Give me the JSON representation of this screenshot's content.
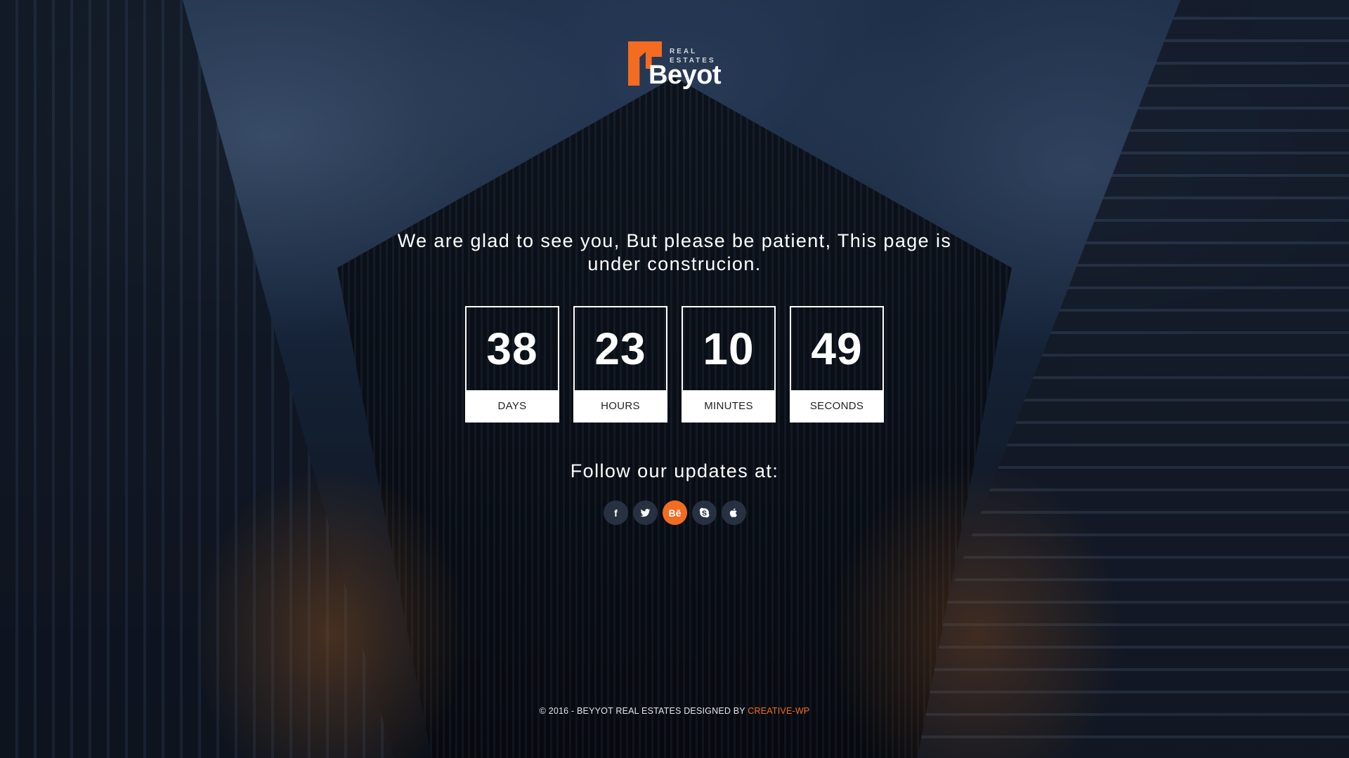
{
  "brand": {
    "subtitle_line1": "REAL",
    "subtitle_line2": "ESTATES",
    "name": "Beyot",
    "accent_color": "#f36c21",
    "logo_icon": "house-roof-icon"
  },
  "headline": "We are glad to see you, But please be patient, This page is under construcion.",
  "countdown": [
    {
      "value": "38",
      "label": "DAYS"
    },
    {
      "value": "23",
      "label": "HOURS"
    },
    {
      "value": "10",
      "label": "MINUTES"
    },
    {
      "value": "49",
      "label": "SECONDS"
    }
  ],
  "follow": {
    "title": "Follow our updates at:",
    "socials": [
      {
        "icon": "facebook-icon",
        "glyph": "f",
        "active": false
      },
      {
        "icon": "twitter-icon",
        "glyph": "",
        "active": false
      },
      {
        "icon": "behance-icon",
        "glyph": "Bē",
        "active": true
      },
      {
        "icon": "skype-icon",
        "glyph": "",
        "active": false
      },
      {
        "icon": "apple-icon",
        "glyph": "",
        "active": false
      }
    ]
  },
  "footer": {
    "text": "© 2016 - BEYYOT REAL ESTATES DESIGNED BY ",
    "link_text": "CREATIVE-WP"
  }
}
